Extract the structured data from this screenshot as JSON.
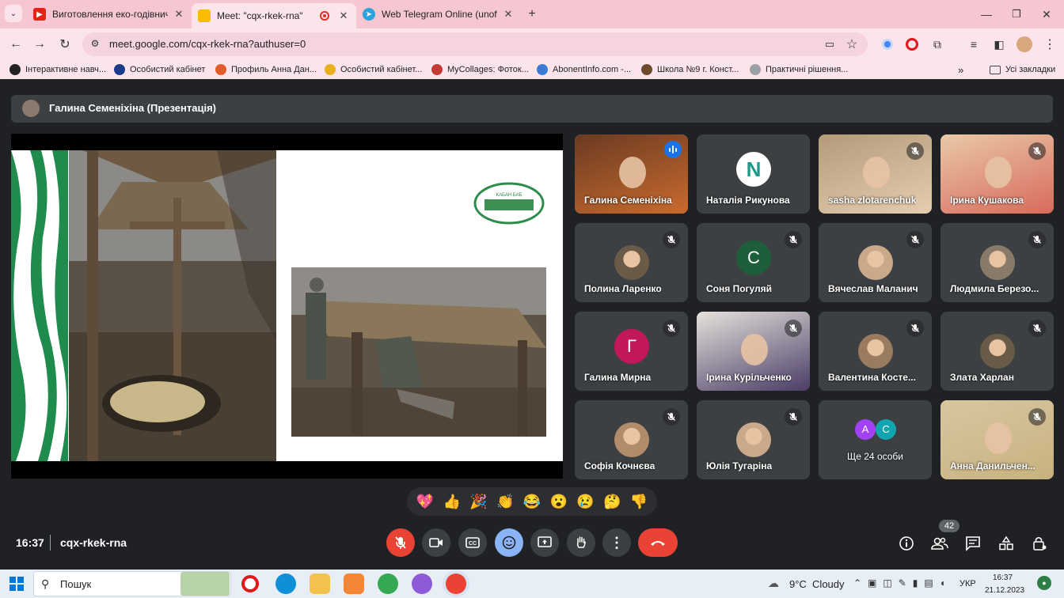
{
  "tabs": [
    {
      "title": "Виготовлення еко-годівничк",
      "icon": "youtube-icon",
      "active": false
    },
    {
      "title": "Meet: \"cqx-rkek-rna\"",
      "icon": "google-meet-icon",
      "active": true
    },
    {
      "title": "Web Telegram Online (unoffici",
      "icon": "telegram-icon",
      "active": false
    }
  ],
  "address": {
    "url": "meet.google.com/cqx-rkek-rna?authuser=0"
  },
  "bookmarks": [
    {
      "label": "Інтерактивне навч...",
      "color": "#222"
    },
    {
      "label": "Особистий кабінет",
      "color": "#1a3a8a"
    },
    {
      "label": "Профиль Анна Дан...",
      "color": "#e25b2a"
    },
    {
      "label": "Особистий кабінет...",
      "color": "#e8b21e"
    },
    {
      "label": "MyCollages: Фоток...",
      "color": "#c23a3a"
    },
    {
      "label": "AbonentInfo.com -...",
      "color": "#3a7bd5"
    },
    {
      "label": "Школа №9 г. Конст...",
      "color": "#6b4b2a"
    },
    {
      "label": "Практичні рішення...",
      "color": "#9aa0a6"
    }
  ],
  "all_bookmarks": "Усі закладки",
  "presenter_label": "Галина Семеніхіна (Презентація)",
  "slide": {
    "logo_text": "КАБАН БАБ"
  },
  "participants": [
    {
      "name": "Галина Семеніхіна",
      "kind": "photo",
      "active": true,
      "muted": false
    },
    {
      "name": "Наталія Рикунова",
      "kind": "logo",
      "letter": "N",
      "muted": false
    },
    {
      "name": "sasha zlotarenchuk",
      "kind": "photo",
      "muted": true
    },
    {
      "name": "Ірина Кушакова",
      "kind": "photo",
      "muted": true
    },
    {
      "name": "Полина Ларенко",
      "kind": "avatar",
      "muted": true
    },
    {
      "name": "Соня Погуляй",
      "kind": "letter",
      "letter": "C",
      "color": "#1e5e3a",
      "muted": true
    },
    {
      "name": "Вячеслав Маланич",
      "kind": "avatar",
      "muted": true
    },
    {
      "name": "Людмила Березо...",
      "kind": "avatar",
      "muted": true
    },
    {
      "name": "Галина Мирна",
      "kind": "letter",
      "letter": "Г",
      "color": "#c2185b",
      "muted": true
    },
    {
      "name": "Ірина Курільченко",
      "kind": "photo",
      "muted": true
    },
    {
      "name": "Валентина Косте...",
      "kind": "avatar",
      "muted": true
    },
    {
      "name": "Злата Харлан",
      "kind": "avatar",
      "muted": true
    },
    {
      "name": "Софія Кочнєва",
      "kind": "avatar",
      "muted": true
    },
    {
      "name": "Юлія Тугаріна",
      "kind": "avatar",
      "muted": true
    },
    {
      "name": "Ще 24 особи",
      "kind": "more",
      "letters": [
        "А",
        "С"
      ]
    },
    {
      "name": "Анна Данильчен...",
      "kind": "photo",
      "muted": true
    }
  ],
  "reactions": [
    "💖",
    "👍",
    "🎉",
    "👏",
    "😂",
    "😮",
    "😢",
    "🤔",
    "👎"
  ],
  "meeting": {
    "time": "16:37",
    "code": "cqx-rkek-rna",
    "people_count": "42"
  },
  "taskbar": {
    "search": "Пошук",
    "weather": "9°C  Cloudy",
    "lang": "УКР",
    "time": "16:37",
    "date": "21.12.2023"
  },
  "colors": {
    "end_call": "#ea4335",
    "mic_off": "#ea4335",
    "accent": "#8ab4f8",
    "tab_strip": "#f7c6d3"
  }
}
